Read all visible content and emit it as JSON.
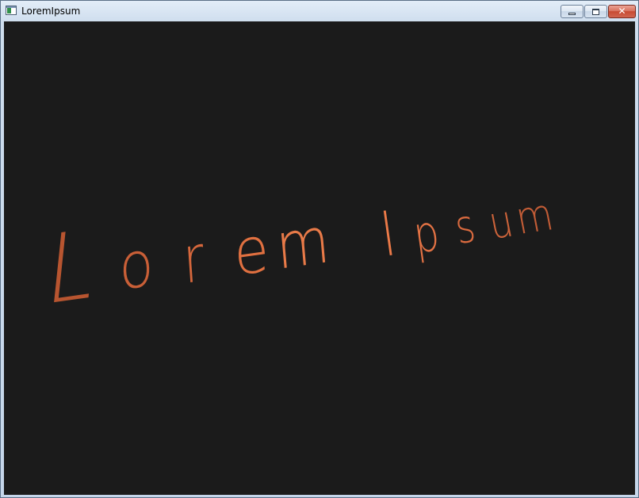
{
  "window": {
    "title": "LoremIpsum",
    "icon": "app-window-icon",
    "controls": {
      "minimize_icon": "minimize-icon",
      "maximize_icon": "maximize-icon",
      "close_icon": "close-icon",
      "close_glyph": "✕"
    },
    "frame_color": "#c5d6ea",
    "close_button_color": "#c74a32"
  },
  "canvas": {
    "background": "#1b1b1b",
    "text": "Lorem Ipsum",
    "letters": [
      "L",
      "o",
      "r",
      "e",
      "m",
      "I",
      "p",
      "s",
      "u",
      "m"
    ],
    "text_color": "#e07040"
  }
}
